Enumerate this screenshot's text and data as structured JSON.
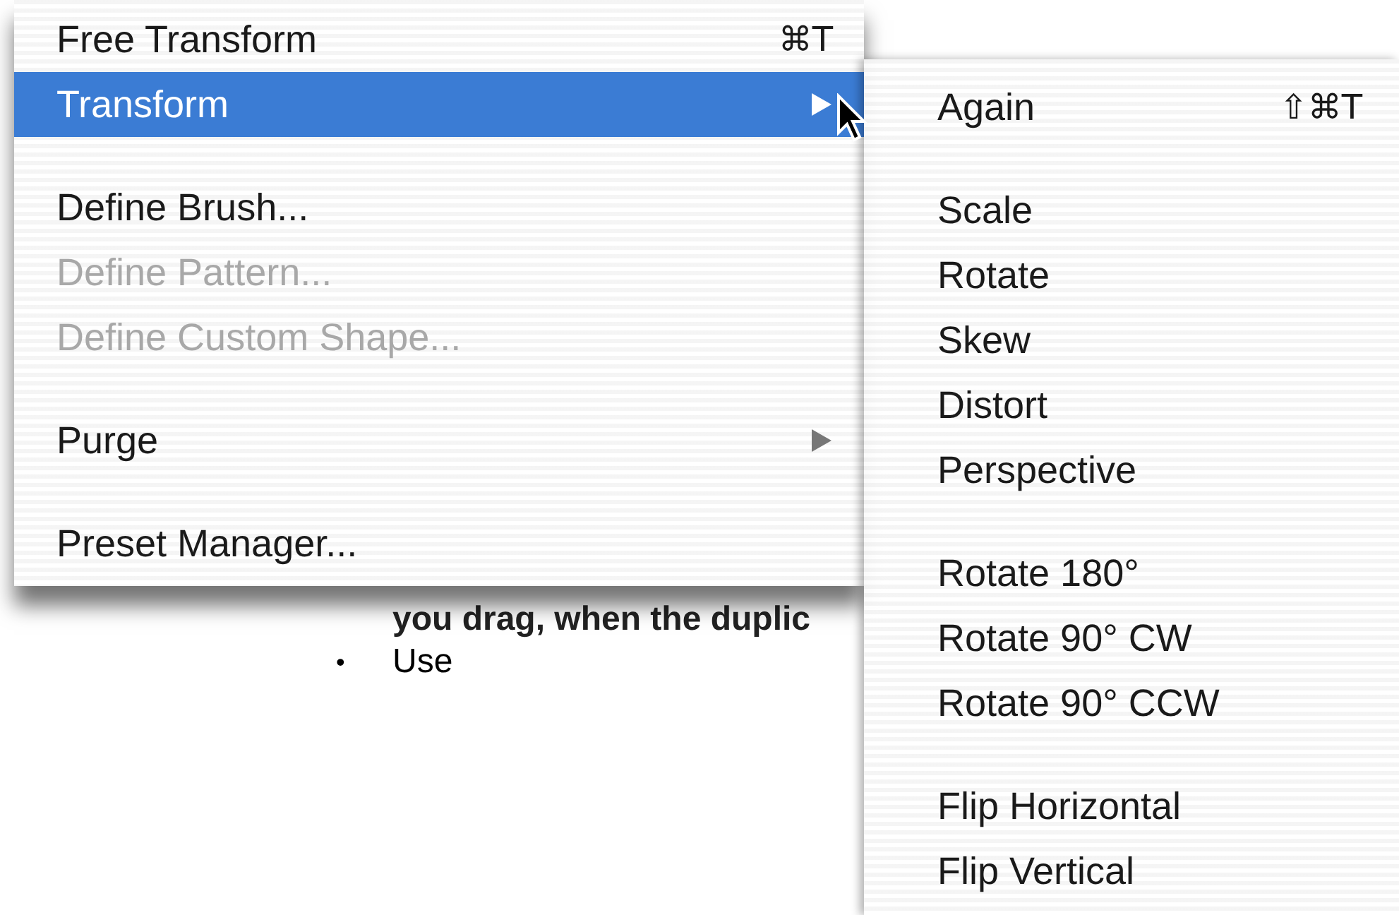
{
  "document": {
    "lines": [
      {
        "kind": "text",
        "text": "you drag, when the duplic"
      },
      {
        "kind": "bullet",
        "bullet": "•",
        "text": "Use"
      }
    ]
  },
  "menu": {
    "items": [
      {
        "kind": "item",
        "label": "Free Transform",
        "shortcut": "⌘T",
        "disabled": false,
        "selected": false
      },
      {
        "kind": "item",
        "label": "Transform",
        "disabled": false,
        "selected": true,
        "submenu": true
      },
      {
        "kind": "separator"
      },
      {
        "kind": "item",
        "label": "Define Brush...",
        "disabled": false,
        "selected": false,
        "submenu": false
      },
      {
        "kind": "item",
        "label": "Define Pattern...",
        "disabled": true,
        "selected": false,
        "submenu": false
      },
      {
        "kind": "item",
        "label": "Define Custom Shape...",
        "disabled": true,
        "selected": false,
        "submenu": false
      },
      {
        "kind": "separator"
      },
      {
        "kind": "item",
        "label": "Purge",
        "disabled": false,
        "selected": false,
        "submenu": true
      },
      {
        "kind": "separator"
      },
      {
        "kind": "item",
        "label": "Preset Manager...",
        "disabled": false,
        "selected": false,
        "submenu": false
      }
    ]
  },
  "submenu": {
    "items": [
      {
        "kind": "item",
        "label": "Again",
        "shortcut": "⇧⌘T",
        "disabled": false,
        "selected": false
      },
      {
        "kind": "separator"
      },
      {
        "kind": "item",
        "label": "Scale",
        "disabled": false,
        "selected": false
      },
      {
        "kind": "item",
        "label": "Rotate",
        "disabled": false,
        "selected": false
      },
      {
        "kind": "item",
        "label": "Skew",
        "disabled": false,
        "selected": false
      },
      {
        "kind": "item",
        "label": "Distort",
        "disabled": false,
        "selected": false
      },
      {
        "kind": "item",
        "label": "Perspective",
        "disabled": false,
        "selected": false
      },
      {
        "kind": "separator"
      },
      {
        "kind": "item",
        "label": "Rotate 180°",
        "disabled": false,
        "selected": false
      },
      {
        "kind": "item",
        "label": "Rotate 90° CW",
        "disabled": false,
        "selected": false
      },
      {
        "kind": "item",
        "label": "Rotate 90° CCW",
        "disabled": false,
        "selected": false
      },
      {
        "kind": "separator"
      },
      {
        "kind": "item",
        "label": "Flip Horizontal",
        "disabled": false,
        "selected": false
      },
      {
        "kind": "item",
        "label": "Flip Vertical",
        "disabled": false,
        "selected": false
      }
    ]
  }
}
